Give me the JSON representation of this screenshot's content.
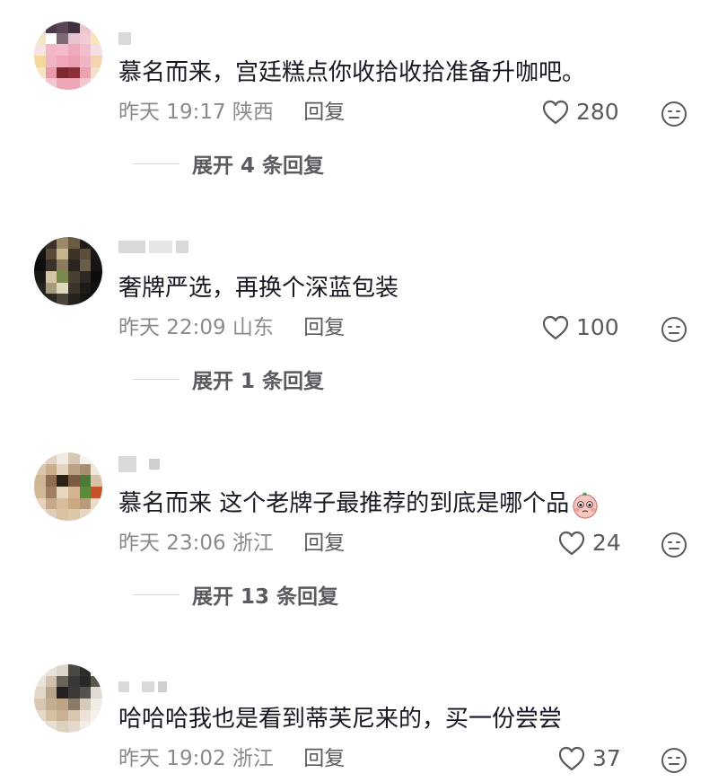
{
  "comments": [
    {
      "text": "慕名而来，宫廷糕点你收拾收拾准备升咖吧。",
      "time": "昨天 19:17",
      "location": "陕西",
      "reply_label": "回复",
      "likes": "280",
      "expand": "展开 4 条回复"
    },
    {
      "text": "奢牌严选，再换个深蓝包装",
      "time": "昨天 22:09",
      "location": "山东",
      "reply_label": "回复",
      "likes": "100",
      "expand": "展开 1 条回复"
    },
    {
      "text": "慕名而来 这个老牌子最推荐的到底是哪个品",
      "time": "昨天 23:06",
      "location": "浙江",
      "reply_label": "回复",
      "likes": "24",
      "expand": "展开 13 条回复"
    },
    {
      "text": "哈哈哈我也是看到蒂芙尼来的，买一份尝尝",
      "time": "昨天 19:02",
      "location": "浙江",
      "reply_label": "回复",
      "likes": "37"
    }
  ],
  "icons": {
    "like": "heart-outline-icon",
    "dislike": "neutral-face-icon",
    "emoji": "pleading-face-emoji"
  },
  "colors": {
    "text": "#161823",
    "meta": "#8a8b91",
    "action": "#5a5b61"
  }
}
